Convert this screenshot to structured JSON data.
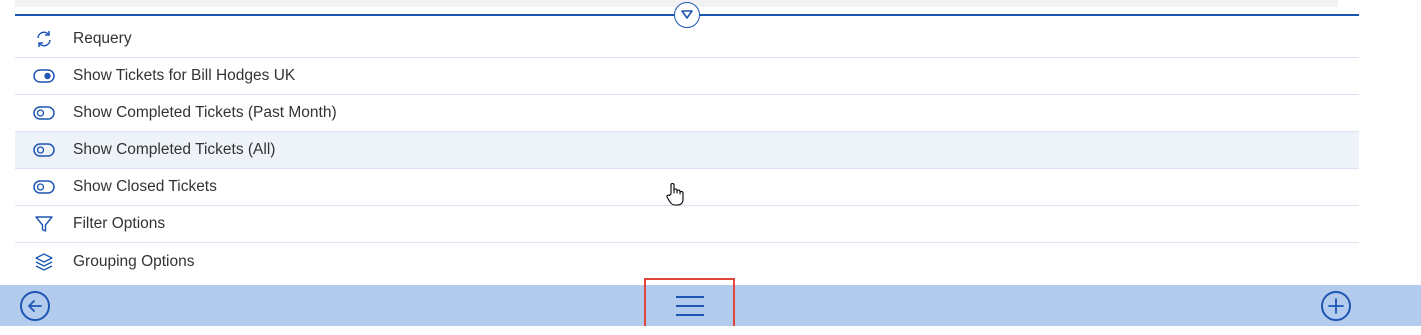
{
  "menu": {
    "items": [
      {
        "label": "Requery",
        "icon": "refresh-icon"
      },
      {
        "label": "Show Tickets for Bill Hodges UK",
        "icon": "toggle-on-icon"
      },
      {
        "label": "Show Completed Tickets (Past Month)",
        "icon": "toggle-off-icon"
      },
      {
        "label": "Show Completed Tickets (All)",
        "icon": "toggle-off-icon"
      },
      {
        "label": "Show Closed Tickets",
        "icon": "toggle-off-icon"
      },
      {
        "label": "Filter Options",
        "icon": "filter-icon"
      },
      {
        "label": "Grouping Options",
        "icon": "layers-icon"
      }
    ]
  },
  "colors": {
    "accent": "#1e56b4",
    "bottom_bar": "#b3ccee",
    "highlight_row": "#eef2f9",
    "selection_box": "#e0473c"
  },
  "icons": {
    "collapse": "chevron-down-circle-icon",
    "back": "arrow-left-circle-icon",
    "menu": "hamburger-menu-icon",
    "add": "plus-circle-icon",
    "cursor": "hand-pointer-icon"
  }
}
